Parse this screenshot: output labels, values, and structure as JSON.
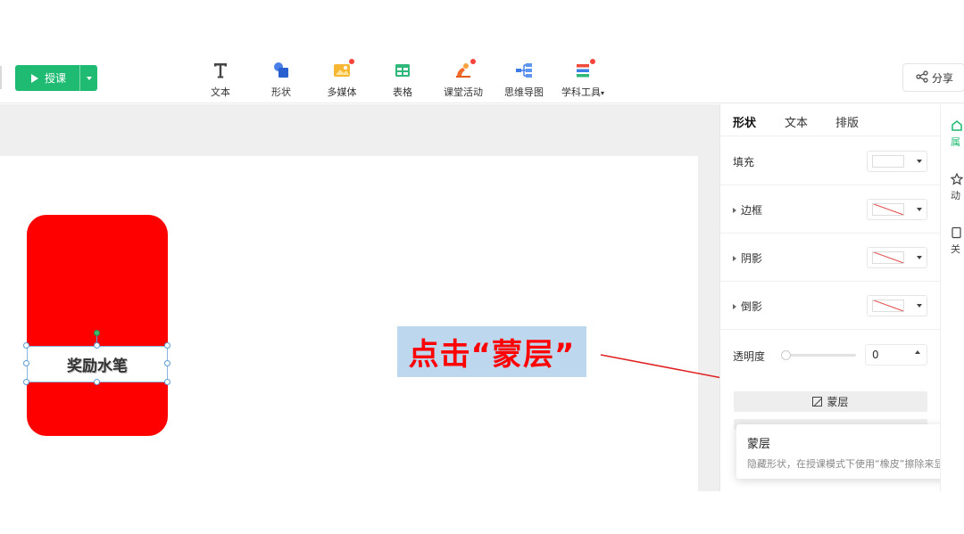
{
  "toolbar": {
    "teach_button": "授课",
    "tools": [
      {
        "label": "文本",
        "icon": "text-icon"
      },
      {
        "label": "形状",
        "icon": "shape-icon"
      },
      {
        "label": "多媒体",
        "icon": "media-icon"
      },
      {
        "label": "表格",
        "icon": "table-icon"
      },
      {
        "label": "课堂活动",
        "icon": "activity-icon"
      },
      {
        "label": "思维导图",
        "icon": "mindmap-icon"
      },
      {
        "label": "学科工具",
        "icon": "subject-tools-icon"
      }
    ],
    "share_button": "分享"
  },
  "canvas": {
    "shape_label": "奖励水笔",
    "shape_fill": "#ff0000"
  },
  "annotation": {
    "callout_text": "点击“蒙层”",
    "callout_color": "#ff0000",
    "callout_bg": "#bdd7ee"
  },
  "panel": {
    "tabs": [
      "形状",
      "文本",
      "排版"
    ],
    "fill_label": "填充",
    "border_label": "边框",
    "shadow_label": "阴影",
    "reflection_label": "倒影",
    "opacity_label": "透明度",
    "opacity_value": "0",
    "mask_button": "蒙层"
  },
  "tooltip": {
    "title": "蒙层",
    "description": "隐藏形状，在授课模式下使用“橡皮”擦除来显示"
  },
  "side_strip": {
    "items": [
      "属",
      "动",
      "关"
    ]
  },
  "colors": {
    "accent": "#1fbb72",
    "red_dot": "#f5433b"
  }
}
